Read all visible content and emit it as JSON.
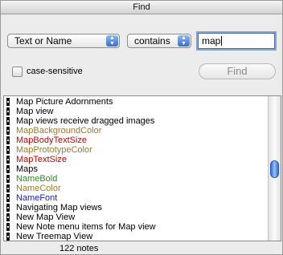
{
  "window": {
    "title": "Find"
  },
  "field_select": {
    "label": "Text or Name"
  },
  "operator_select": {
    "label": "contains"
  },
  "search": {
    "value": "map"
  },
  "options": {
    "case_sensitive_label": "case-sensitive",
    "case_sensitive_checked": false
  },
  "find_button": {
    "label": "Find",
    "enabled": false
  },
  "results": [
    {
      "text": "Map Picture Adornments",
      "color": "#000000"
    },
    {
      "text": "Map view",
      "color": "#000000"
    },
    {
      "text": "Map views receive dragged images",
      "color": "#000000"
    },
    {
      "text": "MapBackgroundColor",
      "color": "#9a7a2a"
    },
    {
      "text": "MapBodyTextSize",
      "color": "#cc0000"
    },
    {
      "text": "MapPrototypeColor",
      "color": "#9a7a2a"
    },
    {
      "text": "MapTextSize",
      "color": "#cc0000"
    },
    {
      "text": "Maps",
      "color": "#000000"
    },
    {
      "text": "NameBold",
      "color": "#2a8a2a"
    },
    {
      "text": "NameColor",
      "color": "#9a7a2a"
    },
    {
      "text": "NameFont",
      "color": "#1a1acc"
    },
    {
      "text": "Navigating Map views",
      "color": "#000000"
    },
    {
      "text": "New Map View",
      "color": "#000000"
    },
    {
      "text": "New Note menu items for Map view",
      "color": "#000000"
    },
    {
      "text": "New Treemap View",
      "color": "#000000"
    }
  ],
  "status": {
    "count_text": "122 notes"
  }
}
